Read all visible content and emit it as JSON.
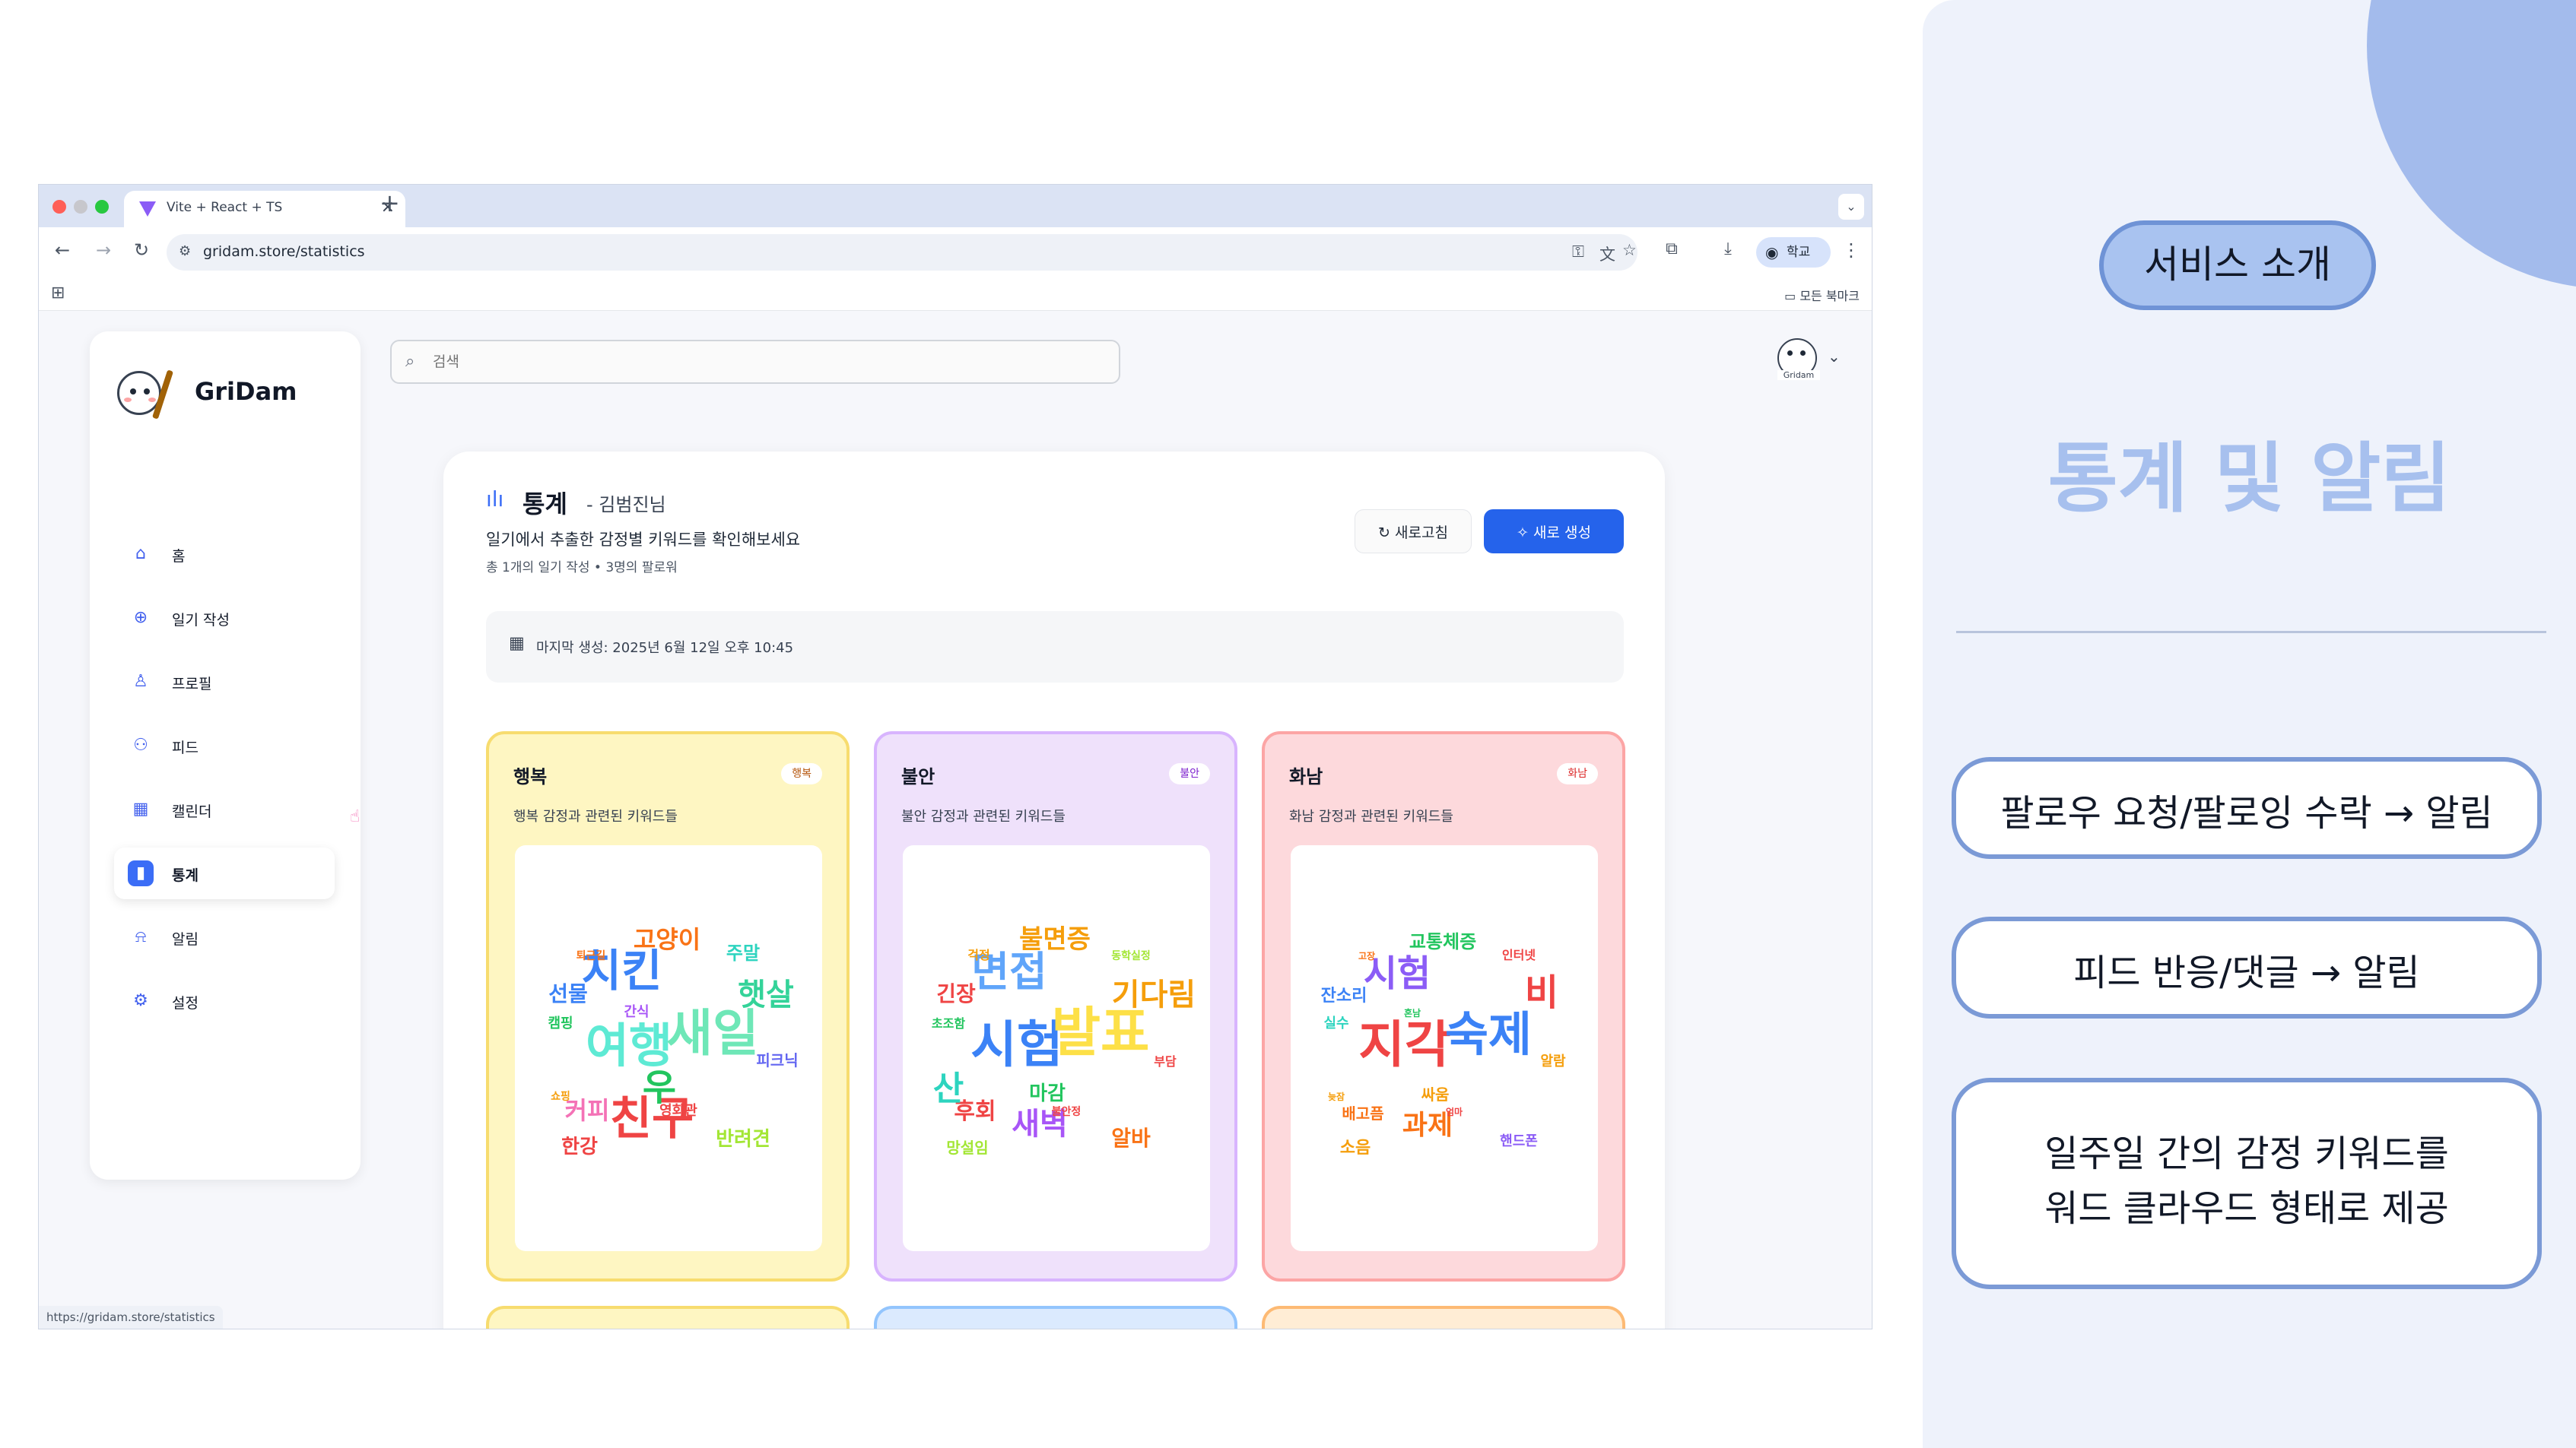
{
  "browser": {
    "tab_title": "Vite + React + TS",
    "tab_close": "×",
    "new_tab": "+",
    "url": "gridam.store/statistics",
    "profile_label": "학교",
    "bookmarks_all": "모든 북마크",
    "status_url": "https://gridam.store/statistics",
    "traffic_colors": [
      "#ff5f57",
      "#c7c7cc",
      "#28c840"
    ]
  },
  "app": {
    "brand": "GriDam",
    "search_placeholder": "검색",
    "avatar_caption": "Gridam",
    "nav": [
      {
        "label": "홈",
        "icon": "home-icon",
        "glyph": "⌂"
      },
      {
        "label": "일기 작성",
        "icon": "plus-circle-icon",
        "glyph": "⊕"
      },
      {
        "label": "프로필",
        "icon": "user-icon",
        "glyph": "♙"
      },
      {
        "label": "피드",
        "icon": "users-icon",
        "glyph": "⚇"
      },
      {
        "label": "캘린더",
        "icon": "calendar-icon",
        "glyph": "▦"
      },
      {
        "label": "통계",
        "icon": "bar-chart-icon",
        "glyph": "▮",
        "active": true
      },
      {
        "label": "알림",
        "icon": "bell-icon",
        "glyph": "⍾"
      },
      {
        "label": "설정",
        "icon": "gear-icon",
        "glyph": "⚙"
      }
    ]
  },
  "stats": {
    "title": "통계",
    "user": "- 김범진님",
    "description": "일기에서 추출한 감정별 키워드를 확인해보세요",
    "meta": "총 1개의 일기 작성 • 3명의 팔로워",
    "refresh_label": "새로고침",
    "new_label": "새로 생성",
    "last_generated": "마지막 생성: 2025년 6월 12일 오후 10:45"
  },
  "emotions": [
    {
      "name": "행복",
      "badge": "행복",
      "desc": "행복 감정과 관련된 키워드들",
      "bg": "#fef6c2",
      "border": "#f7dc6f",
      "badge_color": "#b45309",
      "words": [
        {
          "t": "여행",
          "s": 62,
          "c": "#5eead4"
        },
        {
          "t": "새일",
          "s": 66,
          "c": "#6ee7b7"
        },
        {
          "t": "치킨",
          "s": 58,
          "c": "#3b82f6"
        },
        {
          "t": "친구",
          "s": 60,
          "c": "#ef4444"
        },
        {
          "t": "햇살",
          "s": 40,
          "c": "#34d399"
        },
        {
          "t": "고양이",
          "s": 32,
          "c": "#f97316"
        },
        {
          "t": "커피",
          "s": 32,
          "c": "#f472b6"
        },
        {
          "t": "반려견",
          "s": 26,
          "c": "#a3e635"
        },
        {
          "t": "선물",
          "s": 28,
          "c": "#3b82f6"
        },
        {
          "t": "우",
          "s": 48,
          "c": "#22c55e"
        },
        {
          "t": "한강",
          "s": 26,
          "c": "#ef4444"
        },
        {
          "t": "주말",
          "s": 24,
          "c": "#2dd4bf"
        },
        {
          "t": "피크닉",
          "s": 20,
          "c": "#6366f1"
        },
        {
          "t": "캠핑",
          "s": 18,
          "c": "#22c55e"
        },
        {
          "t": "영화관",
          "s": 18,
          "c": "#ef4444"
        },
        {
          "t": "퇴근길",
          "s": 14,
          "c": "#f97316"
        },
        {
          "t": "쇼핑",
          "s": 14,
          "c": "#f59e0b"
        },
        {
          "t": "간식",
          "s": 18,
          "c": "#a855f7"
        }
      ]
    },
    {
      "name": "불안",
      "badge": "불안",
      "desc": "불안 감정과 관련된 키워드들",
      "bg": "#efe1fb",
      "border": "#d8b4fe",
      "badge_color": "#7e22ce",
      "words": [
        {
          "t": "시험",
          "s": 66,
          "c": "#3b82f6"
        },
        {
          "t": "발표",
          "s": 70,
          "c": "#fde047"
        },
        {
          "t": "면접",
          "s": 54,
          "c": "#60a5fa"
        },
        {
          "t": "새벽",
          "s": 40,
          "c": "#a855f7"
        },
        {
          "t": "기다림",
          "s": 40,
          "c": "#f59e0b"
        },
        {
          "t": "불면증",
          "s": 34,
          "c": "#f59e0b"
        },
        {
          "t": "후회",
          "s": 30,
          "c": "#ef4444"
        },
        {
          "t": "알바",
          "s": 28,
          "c": "#f97316"
        },
        {
          "t": "긴장",
          "s": 28,
          "c": "#ef4444"
        },
        {
          "t": "마감",
          "s": 26,
          "c": "#22c55e"
        },
        {
          "t": "망설임",
          "s": 20,
          "c": "#a3e635"
        },
        {
          "t": "동학실정",
          "s": 14,
          "c": "#a3e635"
        },
        {
          "t": "부담",
          "s": 16,
          "c": "#ef4444"
        },
        {
          "t": "초조함",
          "s": 16,
          "c": "#22c55e"
        },
        {
          "t": "불안정",
          "s": 14,
          "c": "#ef4444"
        },
        {
          "t": "걱정",
          "s": 16,
          "c": "#f59e0b"
        },
        {
          "t": "산",
          "s": 44,
          "c": "#2dd4bf"
        }
      ]
    },
    {
      "name": "화남",
      "badge": "화남",
      "desc": "화남 감정과 관련된 키워드들",
      "bg": "#fdd9dc",
      "border": "#fca5a5",
      "badge_color": "#dc2626",
      "words": [
        {
          "t": "지각",
          "s": 66,
          "c": "#ef4444"
        },
        {
          "t": "숙제",
          "s": 62,
          "c": "#3b82f6"
        },
        {
          "t": "시험",
          "s": 48,
          "c": "#8b5cf6"
        },
        {
          "t": "과제",
          "s": 36,
          "c": "#f97316"
        },
        {
          "t": "비",
          "s": 48,
          "c": "#ef4444"
        },
        {
          "t": "교통체증",
          "s": 24,
          "c": "#22c55e"
        },
        {
          "t": "배고픔",
          "s": 20,
          "c": "#f97316"
        },
        {
          "t": "핸드폰",
          "s": 18,
          "c": "#8b5cf6"
        },
        {
          "t": "잔소리",
          "s": 22,
          "c": "#3b82f6"
        },
        {
          "t": "싸움",
          "s": 20,
          "c": "#f59e0b"
        },
        {
          "t": "소음",
          "s": 22,
          "c": "#f59e0b"
        },
        {
          "t": "인터넷",
          "s": 16,
          "c": "#ef4444"
        },
        {
          "t": "알람",
          "s": 18,
          "c": "#f59e0b"
        },
        {
          "t": "실수",
          "s": 18,
          "c": "#2dd4bf"
        },
        {
          "t": "엄마",
          "s": 12,
          "c": "#ef4444"
        },
        {
          "t": "고장",
          "s": 12,
          "c": "#f97316"
        },
        {
          "t": "늦잠",
          "s": 12,
          "c": "#f59e0b"
        },
        {
          "t": "혼남",
          "s": 12,
          "c": "#22c55e"
        }
      ]
    }
  ],
  "peek_cards": [
    {
      "bg": "#fef6c2",
      "border": "#f7dc6f"
    },
    {
      "bg": "#dbeafe",
      "border": "#93c5fd"
    },
    {
      "bg": "#ffedd5",
      "border": "#fdba74"
    }
  ],
  "panel": {
    "intro_pill": "서비스 소개",
    "title": "통계 및 알림",
    "features": [
      {
        "lines": [
          "팔로우 요청/팔로잉 수락 → 알림"
        ]
      },
      {
        "lines": [
          "피드 반응/댓글 → 알림"
        ]
      },
      {
        "lines": [
          "일주일 간의 감정 키워드를",
          "워드 클라우드 형태로 제공"
        ]
      }
    ]
  }
}
